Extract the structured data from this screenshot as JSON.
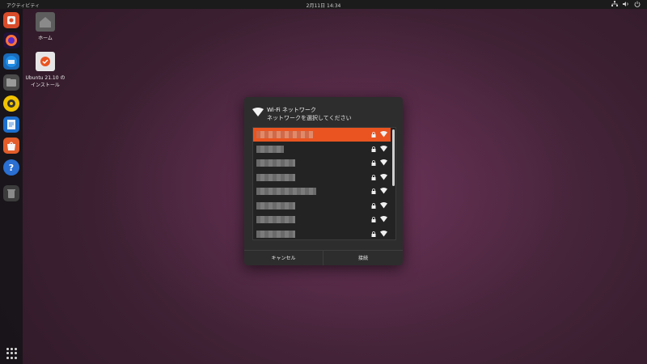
{
  "topbar": {
    "activities": "アクティビティ",
    "clock": "2月11日  14:34"
  },
  "desktop": {
    "icons": [
      {
        "label": "ホーム"
      },
      {
        "label": "Ubuntu 21.10 のインストール"
      }
    ]
  },
  "dialog": {
    "title": "Wi-Fi ネットワーク",
    "subtitle": "ネットワークを選択してください",
    "networks": [
      {
        "name": "██████████",
        "secured": true,
        "selected": true
      },
      {
        "name": "█████",
        "secured": true,
        "selected": false
      },
      {
        "name": "████████",
        "secured": true,
        "selected": false
      },
      {
        "name": "████████",
        "secured": true,
        "selected": false
      },
      {
        "name": "████████████████",
        "secured": true,
        "selected": false
      },
      {
        "name": "████████",
        "secured": true,
        "selected": false
      },
      {
        "name": "████████",
        "secured": true,
        "selected": false
      },
      {
        "name": "████████",
        "secured": true,
        "selected": false
      }
    ],
    "cancel_label": "キャンセル",
    "connect_label": "接続"
  },
  "colors": {
    "accent": "#e95420",
    "dialog_bg": "#2d2d2d",
    "list_bg": "#232323"
  }
}
